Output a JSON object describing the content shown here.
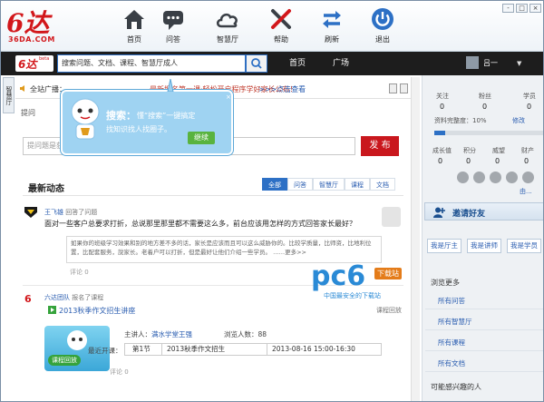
{
  "app": {
    "logo_text": "6达",
    "logo_url": "36DA.COM"
  },
  "toolbar": [
    {
      "label": "首页",
      "icon": "home-icon"
    },
    {
      "label": "问答",
      "icon": "chat-bubble-icon"
    },
    {
      "label": "智慧厅",
      "icon": "cloud-icon"
    },
    {
      "label": "帮助",
      "icon": "tools-icon"
    },
    {
      "label": "刷新",
      "icon": "refresh-icon"
    },
    {
      "label": "退出",
      "icon": "power-icon"
    }
  ],
  "window_controls": [
    "-",
    "□",
    "×"
  ],
  "navbar": {
    "small_logo": "6达",
    "small_logo_tag": "beta",
    "search_placeholder": "搜索问题、文档、课程、智慧厅成人",
    "home": "首页",
    "square": "广场",
    "username": "吕一",
    "caret": "▼"
  },
  "sidetab": "智慧厅",
  "notice": {
    "label": "全站广播：",
    "highlight": "最新报名第一课·轻松开启程序学好家长公布！",
    "link": ">>>点击查看"
  },
  "ask": {
    "tab": "提问",
    "placeholder": "提问题是获",
    "submit": "发 布"
  },
  "feed": {
    "title": "最新动态",
    "tabs": [
      "全部",
      "问答",
      "智慧厅",
      "课程",
      "文档"
    ],
    "item1": {
      "author": "王飞雄",
      "action": "回答了问题",
      "question": "面对一些客户总要求打折，总说那里那里都不需要这么多，前台应该用怎样的方式回答家长最好？",
      "answer": "如果你的班级学习效果和别的地方差不多的话，家长是应该而且可以这么威胁你的。比较学质量，比师资，比地利位置，比配套服务，說家长。老着户可以打折，但是最好让他们介绍一些学员。 ……更多>>",
      "comments": "评论 0"
    },
    "item2": {
      "author": "六达团队",
      "action": "报名了课程",
      "course": "2013秋季作文招生讲座",
      "badge": "课程回放",
      "speaker_label": "主讲人：",
      "speaker": "满水学堂王强",
      "views_label": "浏览人数：",
      "views": "88",
      "next_label": "最近开课：",
      "session": "第1节",
      "session_title": "2013秋季作文招生",
      "session_time": "2013-08-16 15:00-16:30",
      "review": "课程回放",
      "comments": "评论 0"
    }
  },
  "profile": {
    "stats1": [
      {
        "label": "关注",
        "value": "0"
      },
      {
        "label": "粉丝",
        "value": "0"
      },
      {
        "label": "学员",
        "value": "0"
      }
    ],
    "completeness_label": "资料完整度：10%",
    "completeness": 0.1,
    "edit": "修改",
    "stats2": [
      {
        "label": "成长值",
        "value": "0"
      },
      {
        "label": "积分",
        "value": "0"
      },
      {
        "label": "威望",
        "value": "0"
      },
      {
        "label": "财产",
        "value": "0"
      }
    ],
    "more": "由..."
  },
  "invite": "邀请好友",
  "roles": [
    "我是厅主",
    "我是讲师",
    "我是学员"
  ],
  "browse": {
    "title": "浏览更多",
    "links": [
      "所有问答",
      "所有智慧厅",
      "所有课程",
      "所有文档"
    ],
    "footer": "可能感兴趣的人"
  },
  "tooltip": {
    "title": "搜索：",
    "line1": "懂“搜索”一键搞定",
    "line2": "找知识找人找圈子。",
    "button": "继续",
    "close": "×"
  },
  "watermark": {
    "brand": "pc6",
    "tag": "下载站",
    "sub": "中国最安全的下载站"
  },
  "colors": {
    "accent": "#2d70c5",
    "brand_red": "#d2171b",
    "submit_red": "#c9171d"
  }
}
